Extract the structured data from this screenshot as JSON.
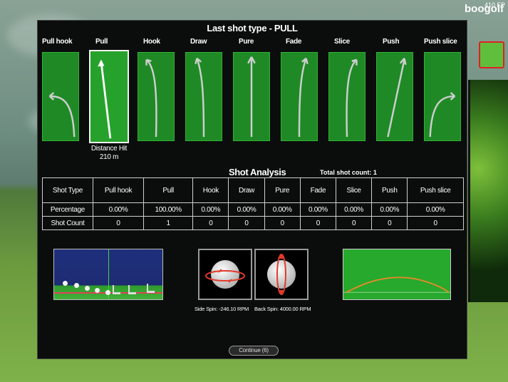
{
  "hud": {
    "fps": "410 FP",
    "logo": "boogolf"
  },
  "dialog": {
    "title": "Last shot type - PULL",
    "shot_types": [
      "Pull hook",
      "Pull",
      "Hook",
      "Draw",
      "Pure",
      "Fade",
      "Slice",
      "Push",
      "Push slice"
    ],
    "selected_shot": "Pull",
    "distance_label": "Distance Hit",
    "distance_value": "210 m"
  },
  "analysis": {
    "title": "Shot Analysis",
    "total_label": "Total shot count: 1",
    "header": [
      "Shot Type",
      "Pull hook",
      "Pull",
      "Hook",
      "Draw",
      "Pure",
      "Fade",
      "Slice",
      "Push",
      "Push slice"
    ],
    "rows": [
      [
        "Percentage",
        "0.00%",
        "100.00%",
        "0.00%",
        "0.00%",
        "0.00%",
        "0.00%",
        "0.00%",
        "0.00%",
        "0.00%"
      ],
      [
        "Shot Count",
        "0",
        "1",
        "0",
        "0",
        "0",
        "0",
        "0",
        "0",
        "0"
      ]
    ]
  },
  "spin": {
    "side_label": "Side Spin: -246.10 RPM",
    "back_label": "Back Spin: 4000.00 RPM"
  },
  "continue_label": "Continue (6)",
  "colors": {
    "card_green": "#1f8a25",
    "selected_border": "#f2f2f2",
    "spin_arrow": "#e23a2a",
    "flight_path": "#e28a2a"
  }
}
